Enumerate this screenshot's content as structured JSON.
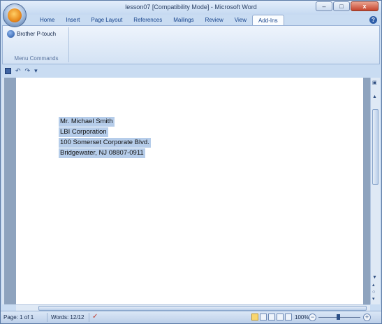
{
  "window": {
    "title": "lesson07 [Compatibility Mode] - Microsoft Word",
    "controls": {
      "minimize": "–",
      "maximize": "□",
      "close": "x"
    }
  },
  "ribbon": {
    "tabs": [
      "Home",
      "Insert",
      "Page Layout",
      "References",
      "Mailings",
      "Review",
      "View",
      "Add-Ins"
    ],
    "active_tab": "Add-Ins",
    "group": {
      "item_label": "Brother P-touch",
      "group_label": "Menu Commands"
    }
  },
  "qat": {
    "undo": "↶",
    "redo": "↷",
    "customize": "▾"
  },
  "document": {
    "lines": [
      "Mr. Michael Smith",
      "LBI Corporation",
      "100 Somerset Corporate Blvd.",
      "Bridgewater, NJ   08807-0911"
    ]
  },
  "status_bar": {
    "page": "Page: 1 of 1",
    "words": "Words: 12/12",
    "zoom": "100%",
    "zoom_minus": "−",
    "zoom_plus": "+"
  }
}
